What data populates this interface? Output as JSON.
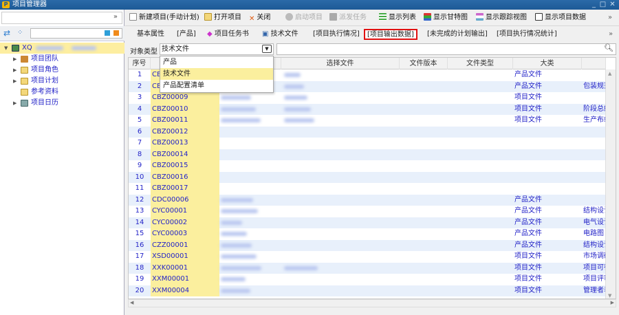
{
  "window": {
    "title": "项目管理器",
    "logo": "P"
  },
  "toolbar": {
    "new_project": "新建项目(手动计划)",
    "open_project": "打开项目",
    "close": "关闭",
    "start_project": "启动项目",
    "dispatch_task": "派发任务",
    "show_list": "显示列表",
    "show_gantt": "显示甘特图",
    "show_tracking": "显示跟踪视图",
    "show_project_data": "显示项目数据"
  },
  "sidebar": {
    "root": "XQ",
    "items": [
      {
        "label": "项目团队",
        "expandable": true
      },
      {
        "label": "项目角色",
        "expandable": true
      },
      {
        "label": "项目计划",
        "expandable": true
      },
      {
        "label": "参考资料",
        "expandable": false
      },
      {
        "label": "项目日历",
        "expandable": true
      }
    ]
  },
  "tabs": [
    {
      "label": "基本属性"
    },
    {
      "label": "[产品]"
    },
    {
      "label": "项目任务书"
    },
    {
      "label": "技术文件"
    },
    {
      "label": "[项目执行情况]"
    },
    {
      "label": "[项目输出数据]",
      "active": true
    },
    {
      "label": "[未完成的计划输出]"
    },
    {
      "label": "[项目执行情况统计]"
    }
  ],
  "filter": {
    "label": "对象类型",
    "value": "技术文件",
    "search_value": ""
  },
  "dropdown": {
    "options": [
      "产品",
      "技术文件",
      "产品配置清单"
    ],
    "highlighted": "技术文件"
  },
  "table": {
    "columns": [
      "序号",
      "",
      "",
      "选择文件",
      "文件版本",
      "文件类型",
      "大类",
      ""
    ],
    "rows": [
      {
        "no": "1",
        "code": "CB",
        "category": "产品文件",
        "sub": "",
        "blur": [
          1,
          1
        ]
      },
      {
        "no": "2",
        "code": "CB",
        "category": "产品文件",
        "sub": "包装规范",
        "blur": [
          1,
          1
        ]
      },
      {
        "no": "3",
        "code": "CBZ00009",
        "category": "项目文件",
        "sub": "",
        "blur": [
          1,
          1
        ]
      },
      {
        "no": "4",
        "code": "CBZ00010",
        "category": "项目文件",
        "sub": "阶段总结",
        "blur": [
          1,
          1
        ]
      },
      {
        "no": "5",
        "code": "CBZ00011",
        "category": "项目文件",
        "sub": "生产布线",
        "blur": [
          1,
          1
        ]
      },
      {
        "no": "6",
        "code": "CBZ00012",
        "category": "",
        "sub": "",
        "blur": [
          0,
          0
        ]
      },
      {
        "no": "7",
        "code": "CBZ00013",
        "category": "",
        "sub": "",
        "blur": [
          0,
          0
        ]
      },
      {
        "no": "8",
        "code": "CBZ00014",
        "category": "",
        "sub": "",
        "blur": [
          0,
          0
        ]
      },
      {
        "no": "9",
        "code": "CBZ00015",
        "category": "",
        "sub": "",
        "blur": [
          0,
          0
        ]
      },
      {
        "no": "10",
        "code": "CBZ00016",
        "category": "",
        "sub": "",
        "blur": [
          0,
          0
        ]
      },
      {
        "no": "11",
        "code": "CBZ00017",
        "category": "",
        "sub": "",
        "blur": [
          0,
          0
        ]
      },
      {
        "no": "12",
        "code": "CDC00006",
        "category": "产品文件",
        "sub": "",
        "blur": [
          1,
          0
        ]
      },
      {
        "no": "13",
        "code": "CYC00001",
        "category": "产品文件",
        "sub": "结构设计",
        "blur": [
          1,
          0
        ]
      },
      {
        "no": "14",
        "code": "CYC00002",
        "category": "产品文件",
        "sub": "电气设计",
        "blur": [
          1,
          0
        ]
      },
      {
        "no": "15",
        "code": "CYC00003",
        "category": "产品文件",
        "sub": "电路图",
        "blur": [
          1,
          0
        ]
      },
      {
        "no": "16",
        "code": "CZZ00001",
        "category": "产品文件",
        "sub": "结构设计",
        "blur": [
          1,
          0
        ]
      },
      {
        "no": "17",
        "code": "XSD00001",
        "category": "项目文件",
        "sub": "市场调研",
        "blur": [
          1,
          0
        ]
      },
      {
        "no": "18",
        "code": "XXK00001",
        "category": "项目文件",
        "sub": "项目可行",
        "blur": [
          1,
          1
        ]
      },
      {
        "no": "19",
        "code": "XXM00001",
        "category": "项目文件",
        "sub": "项目评审",
        "blur": [
          1,
          0
        ]
      },
      {
        "no": "20",
        "code": "XXM00004",
        "category": "项目文件",
        "sub": "管理者表",
        "blur": [
          1,
          0
        ]
      }
    ]
  }
}
